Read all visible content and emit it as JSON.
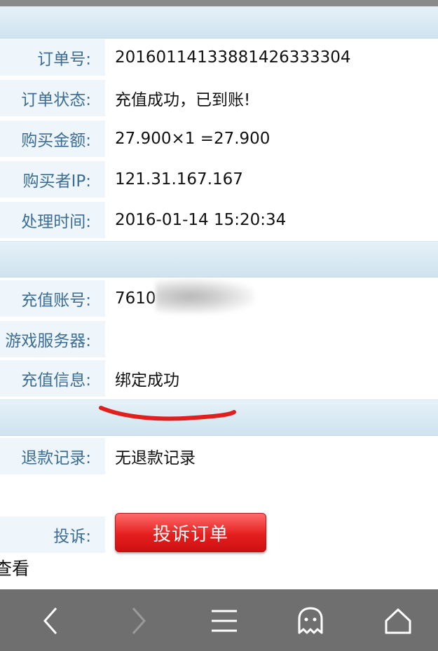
{
  "order_info": {
    "order_no": {
      "label": "订单号:",
      "value": "20160114133881426333304"
    },
    "order_status": {
      "label": "订单状态:",
      "value": "充值成功，已到账!"
    },
    "amount": {
      "label": "购买金额:",
      "value": "27.900×1 =27.900"
    },
    "buyer_ip": {
      "label": "购买者IP:",
      "value": "121.31.167.167"
    },
    "process_time": {
      "label": "处理时间:",
      "value": "2016-01-14 15:20:34"
    }
  },
  "recharge_info": {
    "account": {
      "label": "充值账号:",
      "value": "7610"
    },
    "server": {
      "label": "游戏服务器:",
      "value": ""
    },
    "message": {
      "label": "充值信息:",
      "value": "绑定成功"
    }
  },
  "refund": {
    "label": "退款记录:",
    "value": "无退款记录"
  },
  "complaint": {
    "label": "投诉:",
    "button_label": "投诉订单"
  },
  "view_link": "查看",
  "bottom_nav": [
    "back-icon",
    "forward-icon",
    "menu-icon",
    "ghost-icon",
    "home-icon"
  ],
  "colors": {
    "label_text": "#3b6d96",
    "label_bg": "#eef6fb",
    "button_red": "#e51f1f",
    "nav_bar": "#6f6f6f"
  }
}
